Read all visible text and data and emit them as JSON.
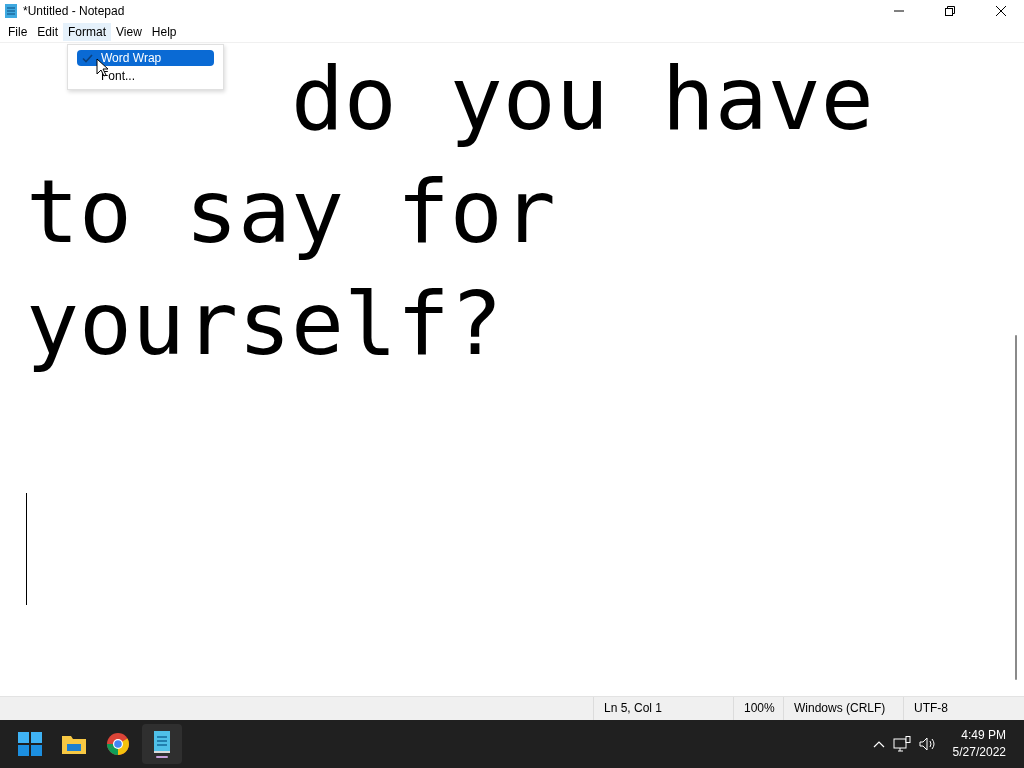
{
  "window": {
    "title": "*Untitled - Notepad"
  },
  "menu": [
    {
      "label": "File",
      "selected": false
    },
    {
      "label": "Edit",
      "selected": false
    },
    {
      "label": "Format",
      "selected": true
    },
    {
      "label": "View",
      "selected": false
    },
    {
      "label": "Help",
      "selected": false
    }
  ],
  "dropdown": [
    {
      "label": "Word Wrap",
      "checked": true,
      "selected": true
    },
    {
      "label": "Font...",
      "checked": false,
      "selected": false
    }
  ],
  "document": {
    "lines": [
      "do you have",
      "to say for",
      "yourself?"
    ]
  },
  "status_bar": [
    "Ln 5, Col 1",
    "100%",
    "Windows (CRLF)",
    "UTF-8"
  ],
  "taskbar": {
    "time": "4:49 PM",
    "date": "5/27/2022"
  }
}
